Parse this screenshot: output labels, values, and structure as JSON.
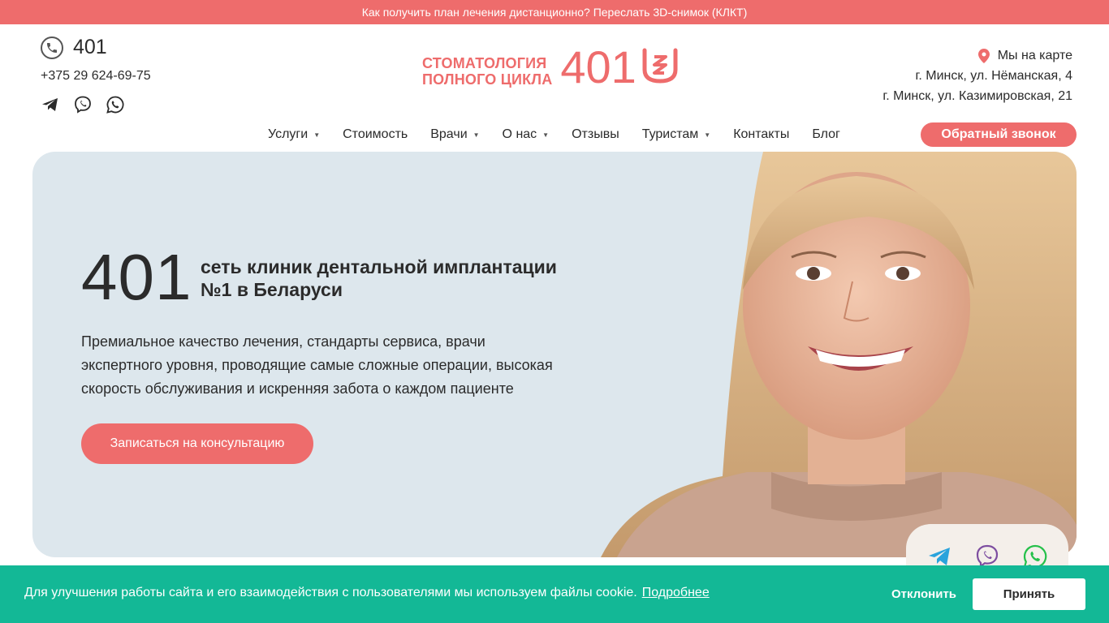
{
  "topbar": {
    "text": "Как получить план лечения дистанционно? Переслать 3D-снимок (КЛКТ)"
  },
  "header": {
    "short_phone": "401",
    "phone": "+375 29 624-69-75",
    "messengers": [
      "telegram-icon",
      "viber-icon",
      "whatsapp-icon"
    ],
    "logo": {
      "line1": "СТОМАТОЛОГИЯ",
      "line2": "ПОЛНОГО ЦИКЛА",
      "number": "401"
    },
    "map_link": "Мы на карте",
    "addresses": [
      "г. Минск, ул. Нёманская, 4",
      "г. Минск, ул. Казимировская, 21"
    ],
    "callback_label": "Обратный звонок"
  },
  "nav": {
    "items": [
      {
        "label": "Услуги",
        "dropdown": true
      },
      {
        "label": "Стоимость",
        "dropdown": false
      },
      {
        "label": "Врачи",
        "dropdown": true
      },
      {
        "label": "О нас",
        "dropdown": true
      },
      {
        "label": "Отзывы",
        "dropdown": false
      },
      {
        "label": "Туристам",
        "dropdown": true
      },
      {
        "label": "Контакты",
        "dropdown": false
      },
      {
        "label": "Блог",
        "dropdown": false
      }
    ],
    "caret": "▼"
  },
  "hero": {
    "number": "401",
    "title_line1": "сеть клиник дентальной имплантации",
    "title_line2": "№1 в Беларуси",
    "desc_line1": "Премиальное качество лечения, стандарты сервиса, врачи",
    "desc_line2": "экспертного уровня, проводящие самые сложные операции, высокая",
    "desc_line3": "скорость обслуживания и искренняя забота о каждом пациенте",
    "cta": "Записаться на консультацию"
  },
  "cookie": {
    "text": "Для улучшения работы сайта и его взаимодействия с пользователями мы используем файлы cookie.",
    "link": "Подробнее",
    "decline": "Отклонить",
    "accept": "Принять"
  },
  "colors": {
    "accent": "#ee6c6c",
    "hero_bg": "#dde7ed",
    "cookie_bg": "#13b896"
  }
}
